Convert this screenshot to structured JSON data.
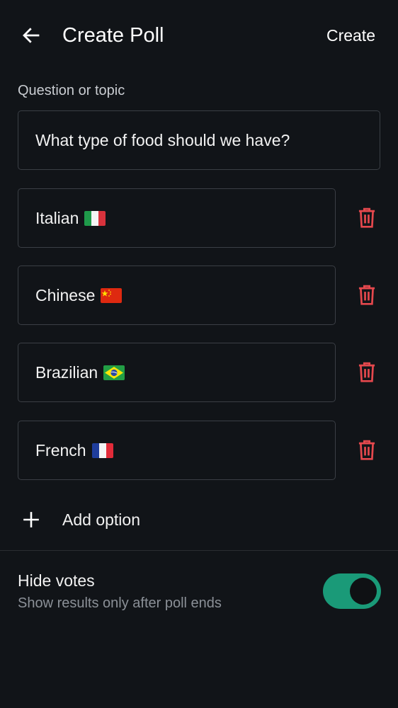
{
  "header": {
    "title": "Create Poll",
    "create_label": "Create"
  },
  "question": {
    "label": "Question or topic",
    "value": "What type of food should we have?"
  },
  "options": [
    {
      "label": "Italian",
      "flag": "flag-italy-icon"
    },
    {
      "label": "Chinese",
      "flag": "flag-china-icon"
    },
    {
      "label": "Brazilian",
      "flag": "flag-brazil-icon"
    },
    {
      "label": "French",
      "flag": "flag-france-icon"
    }
  ],
  "add_option_label": "Add option",
  "hide_votes": {
    "title": "Hide votes",
    "subtitle": "Show results only after poll ends",
    "enabled": true
  },
  "colors": {
    "background": "#111418",
    "danger": "#e5484d",
    "toggle_on": "#1a9a78"
  },
  "icons": {
    "back": "arrow-left-icon",
    "delete": "trash-icon",
    "add": "plus-icon"
  }
}
